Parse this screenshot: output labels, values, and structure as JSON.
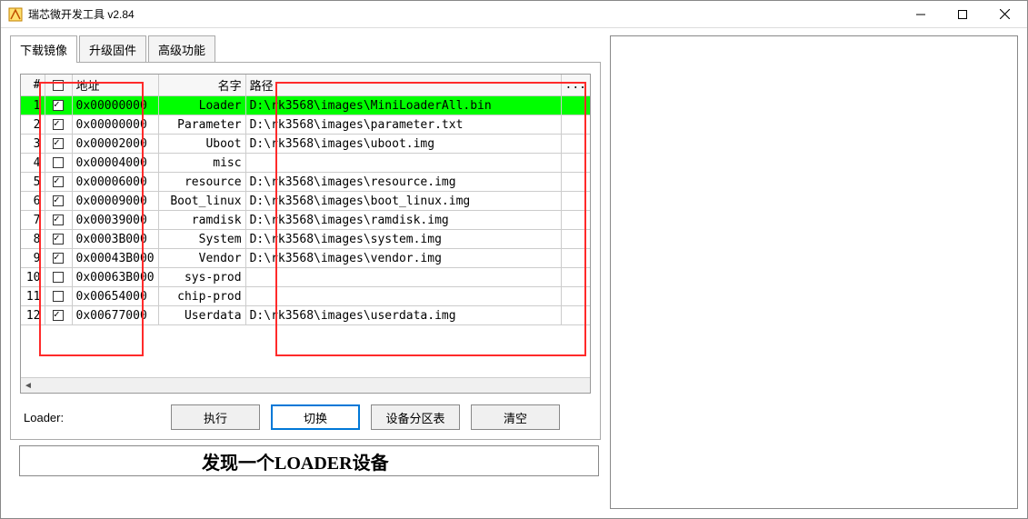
{
  "window": {
    "title": "瑞芯微开发工具 v2.84"
  },
  "tabs": {
    "t1": "下载镜像",
    "t2": "升级固件",
    "t3": "高级功能"
  },
  "headers": {
    "num": "#",
    "check": "口",
    "addr": "地址",
    "name": "名字",
    "path": "路径",
    "ext": "..."
  },
  "rows": [
    {
      "n": "1",
      "c": true,
      "addr": "0x00000000",
      "name": "Loader",
      "path": "D:\\rk3568\\images\\MiniLoaderAll.bin",
      "sel": true
    },
    {
      "n": "2",
      "c": true,
      "addr": "0x00000000",
      "name": "Parameter",
      "path": "D:\\rk3568\\images\\parameter.txt"
    },
    {
      "n": "3",
      "c": true,
      "addr": "0x00002000",
      "name": "Uboot",
      "path": "D:\\rk3568\\images\\uboot.img"
    },
    {
      "n": "4",
      "c": false,
      "addr": "0x00004000",
      "name": "misc",
      "path": ""
    },
    {
      "n": "5",
      "c": true,
      "addr": "0x00006000",
      "name": "resource",
      "path": "D:\\rk3568\\images\\resource.img"
    },
    {
      "n": "6",
      "c": true,
      "addr": "0x00009000",
      "name": "Boot_linux",
      "path": "D:\\rk3568\\images\\boot_linux.img"
    },
    {
      "n": "7",
      "c": true,
      "addr": "0x00039000",
      "name": "ramdisk",
      "path": "D:\\rk3568\\images\\ramdisk.img"
    },
    {
      "n": "8",
      "c": true,
      "addr": "0x0003B000",
      "name": "System",
      "path": "D:\\rk3568\\images\\system.img"
    },
    {
      "n": "9",
      "c": true,
      "addr": "0x00043B000",
      "name": "Vendor",
      "path": "D:\\rk3568\\images\\vendor.img"
    },
    {
      "n": "10",
      "c": false,
      "addr": "0x00063B000",
      "name": "sys-prod",
      "path": ""
    },
    {
      "n": "11",
      "c": false,
      "addr": "0x00654000",
      "name": "chip-prod",
      "path": ""
    },
    {
      "n": "12",
      "c": true,
      "addr": "0x00677000",
      "name": "Userdata",
      "path": "D:\\rk3568\\images\\userdata.img"
    }
  ],
  "loaderLabel": "Loader:",
  "buttons": {
    "exec": "执行",
    "switch": "切换",
    "parttable": "设备分区表",
    "clear": "清空"
  },
  "status": "发现一个LOADER设备"
}
